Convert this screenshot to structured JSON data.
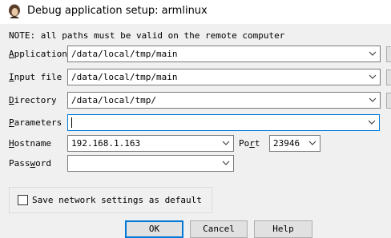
{
  "window": {
    "title": "Debug application setup: armlinux"
  },
  "note": "NOTE: all paths must be valid on the remote computer",
  "fields": {
    "application": {
      "label_key": "A",
      "label_rest": "pplication",
      "value": "/data/local/tmp/main"
    },
    "input_file": {
      "label_key": "I",
      "label_rest": "nput file",
      "value": "/data/local/tmp/main"
    },
    "directory": {
      "label_key": "D",
      "label_rest": "irectory",
      "value": "/data/local/tmp/"
    },
    "parameters": {
      "label_key": "P",
      "label_rest": "arameters",
      "value": ""
    },
    "hostname": {
      "label_key": "H",
      "label_rest": "ostname",
      "value": "192.168.1.163"
    },
    "port": {
      "label_pre": "Po",
      "label_key": "r",
      "label_rest": "t",
      "value": "23946"
    },
    "password": {
      "label_pre": "Pass",
      "label_key": "w",
      "label_rest": "ord",
      "value": ""
    }
  },
  "save_settings": {
    "label": "Save network settings as default",
    "checked": false
  },
  "buttons": {
    "ok": "OK",
    "cancel": "Cancel",
    "help": "Help"
  }
}
